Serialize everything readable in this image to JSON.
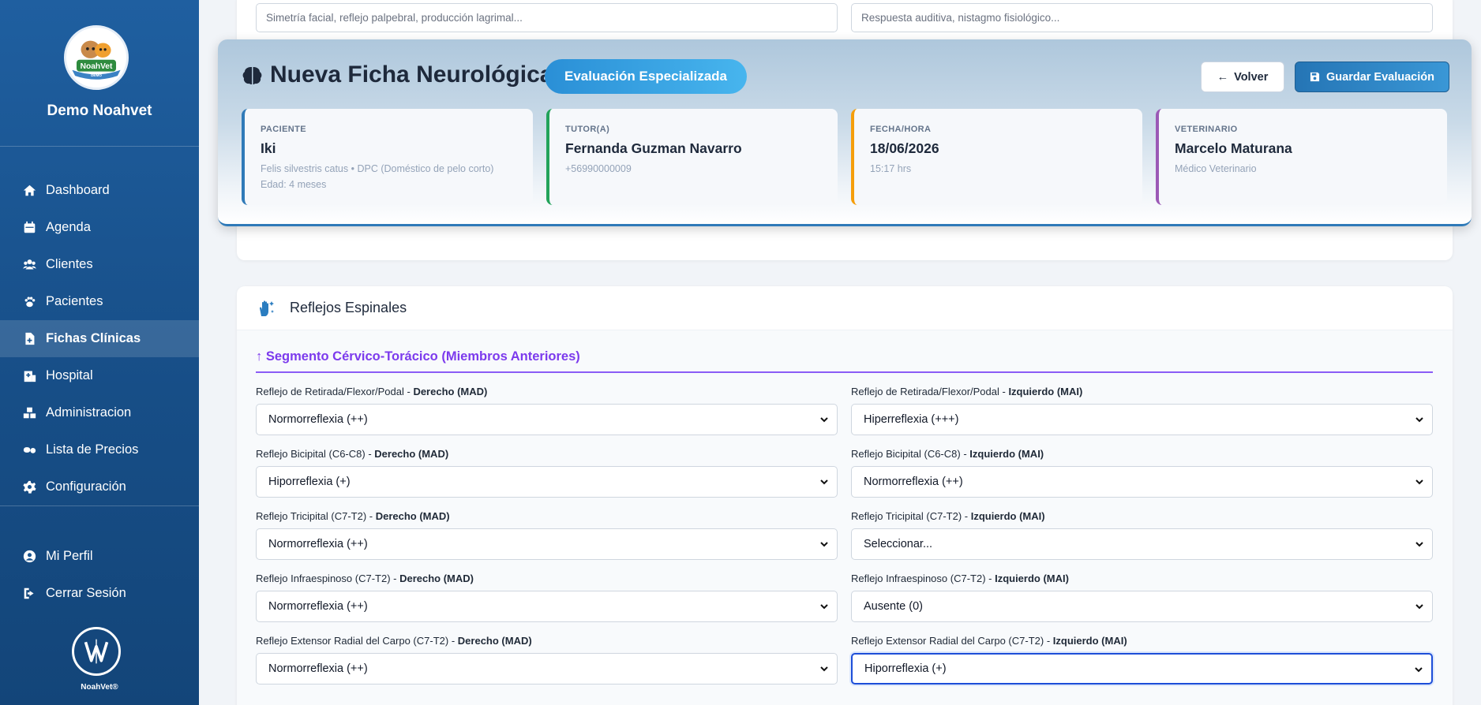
{
  "sidebar": {
    "brand": "Demo Noahvet",
    "logo_text": "NoahVet",
    "logo_sub": "DEMO",
    "items": [
      {
        "label": "Dashboard",
        "icon": "home-icon"
      },
      {
        "label": "Agenda",
        "icon": "calendar-icon"
      },
      {
        "label": "Clientes",
        "icon": "users-icon"
      },
      {
        "label": "Pacientes",
        "icon": "paw-icon"
      },
      {
        "label": "Fichas Clínicas",
        "icon": "file-medical-icon"
      },
      {
        "label": "Hospital",
        "icon": "hospital-icon"
      },
      {
        "label": "Administracion",
        "icon": "boxes-icon"
      },
      {
        "label": "Lista de Precios",
        "icon": "pills-icon"
      },
      {
        "label": "Configuración",
        "icon": "gear-icon"
      }
    ],
    "bottom_items": [
      {
        "label": "Mi Perfil",
        "icon": "user-circle-icon"
      },
      {
        "label": "Cerrar Sesión",
        "icon": "logout-icon"
      }
    ],
    "footer_brand": "NoahVet®"
  },
  "top_inputs": {
    "left_placeholder": "Simetría facial, reflejo palpebral, producción lagrimal...",
    "right_placeholder": "Respuesta auditiva, nistagmo fisiológico..."
  },
  "header": {
    "title": "Nueva Ficha Neurológica",
    "badge": "Evaluación Especializada",
    "back_label": "Volver",
    "save_label": "Guardar Evaluación"
  },
  "info": {
    "patient": {
      "label": "PACIENTE",
      "value": "Iki",
      "sub1": "Felis silvestris catus • DPC (Doméstico de pelo corto)",
      "sub2": "Edad: 4 meses",
      "color": "#2f7ab8"
    },
    "tutor": {
      "label": "TUTOR(A)",
      "value": "Fernanda Guzman Navarro",
      "sub1": "+56990000009",
      "color": "#22a35a"
    },
    "date": {
      "label": "FECHA/HORA",
      "value": "18/06/2026",
      "sub1": "15:17 hrs",
      "color": "#f59e0b"
    },
    "vet": {
      "label": "VETERINARIO",
      "value": "Marcelo Maturana",
      "sub1": "Médico Veterinario",
      "color": "#9b59b6"
    }
  },
  "section": {
    "title": "Reflejos Espinales",
    "segment_title": "↑ Segmento Cérvico-Torácico (Miembros Anteriores)",
    "fields": [
      {
        "label": "Reflejo de Retirada/Flexor/Podal - ",
        "side_r": "Derecho (MAD)",
        "side_l": "Izquierdo (MAI)",
        "right_value": "Normorreflexia (++)",
        "left_value": "Hiperreflexia (+++)"
      },
      {
        "label": "Reflejo Bicipital (C6-C8) - ",
        "side_r": "Derecho (MAD)",
        "side_l": "Izquierdo (MAI)",
        "right_value": "Hiporreflexia (+)",
        "left_value": "Normorreflexia (++)"
      },
      {
        "label": "Reflejo Tricipital (C7-T2) - ",
        "side_r": "Derecho (MAD)",
        "side_l": "Izquierdo (MAI)",
        "right_value": "Normorreflexia (++)",
        "left_value": "Seleccionar..."
      },
      {
        "label": "Reflejo Infraespinoso (C7-T2) - ",
        "side_r": "Derecho (MAD)",
        "side_l": "Izquierdo (MAI)",
        "right_value": "Normorreflexia (++)",
        "left_value": "Ausente (0)"
      },
      {
        "label": "Reflejo Extensor Radial del Carpo (C7-T2) - ",
        "side_r": "Derecho (MAD)",
        "side_l": "Izquierdo (MAI)",
        "right_value": "Normorreflexia (++)",
        "left_value": "Hiporreflexia (+)"
      }
    ]
  }
}
